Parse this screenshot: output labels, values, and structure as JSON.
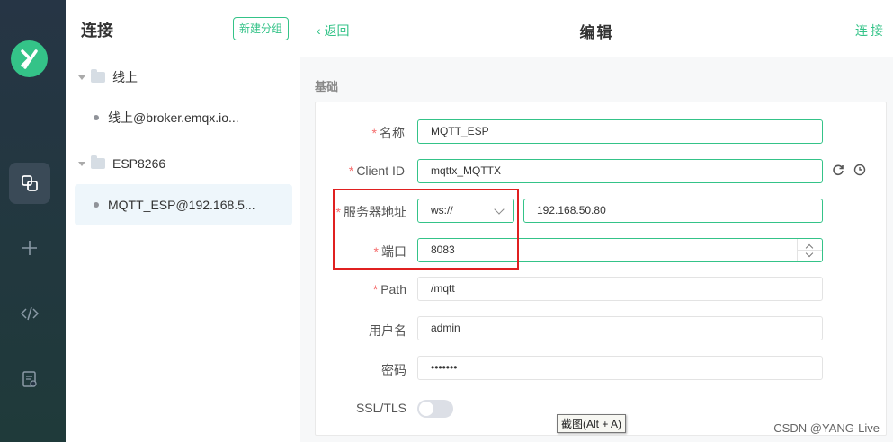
{
  "sidebar_nav": {
    "items": [
      "connections-icon",
      "plus-icon",
      "code-icon",
      "log-icon"
    ],
    "accent": "#34c388"
  },
  "connections": {
    "title": "连接",
    "new_group_label": "新建分组",
    "groups": [
      {
        "name": "线上",
        "items": [
          {
            "label": "线上@broker.emqx.io..."
          }
        ]
      },
      {
        "name": "ESP8266",
        "items": [
          {
            "label": "MQTT_ESP@192.168.5..."
          }
        ]
      }
    ]
  },
  "header": {
    "back_label": "返回",
    "title": "编辑",
    "connect_label": "连接"
  },
  "section_title": "基础",
  "form": {
    "name_label": "名称",
    "name_value": "MQTT_ESP",
    "client_id_label": "Client ID",
    "client_id_value": "mqttx_MQTTX",
    "host_label": "服务器地址",
    "protocol_value": "ws://",
    "host_value": "192.168.50.80",
    "port_label": "端口",
    "port_value": "8083",
    "path_label": "Path",
    "path_value": "/mqtt",
    "username_label": "用户名",
    "username_value": "admin",
    "password_label": "密码",
    "password_value": "•••••••",
    "ssl_label": "SSL/TLS",
    "ssl_enabled": false,
    "required_mark": "*"
  },
  "tooltip": "截图(Alt + A)",
  "watermark": "CSDN @YANG-Live"
}
